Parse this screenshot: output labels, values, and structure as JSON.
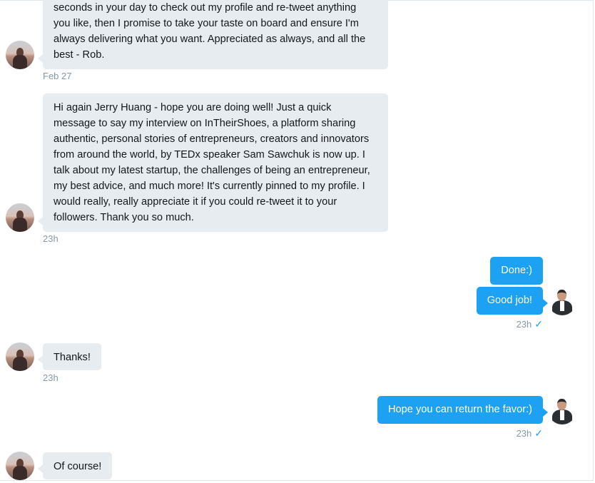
{
  "conversation": {
    "messages": [
      {
        "direction": "incoming",
        "lines": [
          "seconds in your day to check out my profile and re-tweet anything",
          "you like, then I promise to take your taste on board and ensure I'm",
          "always delivering what you want. Appreciated as always, and all the",
          "best - Rob."
        ],
        "timestamp": "Feb 27"
      },
      {
        "direction": "incoming",
        "lines": [
          "Hi again Jerry Huang - hope you are doing well! Just a quick",
          "message to say my interview on InTheirShoes, a platform sharing",
          "authentic, personal stories of entrepreneurs, creators and innovators",
          "from around the world, by TEDx speaker Sam Sawchuk is now up. I",
          "talk about my latest startup, the challenges of being an entrepreneur,",
          "my best advice, and much more! It's currently pinned to my profile. I",
          "would really, really appreciate it if you could re-tweet it to your",
          "followers. Thank you so much."
        ],
        "timestamp": "23h"
      },
      {
        "direction": "outgoing",
        "text": "Done:)"
      },
      {
        "direction": "outgoing",
        "text": "Good job!",
        "timestamp": "23h",
        "read_icon": "checkmark-icon"
      },
      {
        "direction": "incoming",
        "text": "Thanks!",
        "timestamp": "23h"
      },
      {
        "direction": "outgoing",
        "text": "Hope you can return the favor:)",
        "timestamp": "23h",
        "read_icon": "checkmark-icon"
      },
      {
        "direction": "incoming",
        "text": "Of course!"
      }
    ],
    "check_glyph": "✓",
    "colors": {
      "incoming_bubble": "#e6ecf0",
      "outgoing_bubble": "#1da1f2",
      "timestamp": "#8899a6"
    }
  }
}
